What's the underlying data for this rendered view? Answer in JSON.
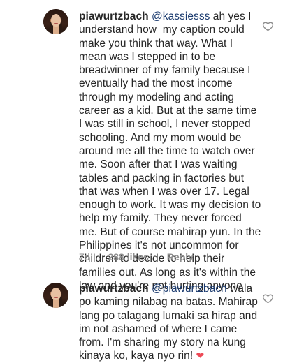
{
  "comments": [
    {
      "username": "piawurtzbach",
      "mention": "@kassiesss",
      "text": "ah yes I understand how  my caption could make you think that way. What I mean was I stepped in to be breadwinner of my family because I eventually had the most income through my modeling and acting career as a kid. But at the same time I was still in school, I never stopped schooling. And my mom would be around me all the time to watch over me. Soon after that I was waiting tables and packing in factories but that was when I was over 17. Legal enough to work. It was my decision to help my family. They never forced me. But of course mahirap yun. In the Philippines it's not uncommon for children to decide to help their families out. As long as it's within the law and you're not hurting anyone",
      "time": "7d",
      "likes": "288 likes",
      "reply": "Reply"
    },
    {
      "username": "piawurtzbach",
      "mention": "@piawurtzbach",
      "text": "wala po kaming nilabag na batas. Mahirap lang po talagang lumaki sa hirap and im not ashamed of where I came from. I'm sharing my story na kung kinaya ko, kaya nyo rin!",
      "emoji": "❤"
    }
  ],
  "icons": {
    "like": "heart-outline-icon",
    "emoji": "red-heart-emoji"
  },
  "colors": {
    "mention": "#1b3b6f",
    "meta": "#8e8e8e",
    "emoji_heart": "#ed4956"
  }
}
